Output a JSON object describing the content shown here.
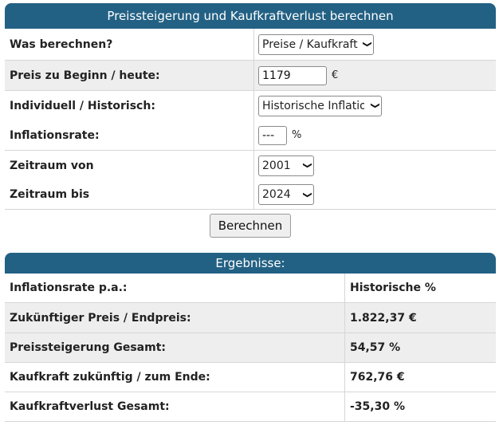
{
  "calc": {
    "title": "Preissteigerung und Kaufkraftverlust berechnen",
    "rows": {
      "what": {
        "label": "Was berechnen?",
        "select": "Preise / Kaufkraft"
      },
      "price": {
        "label": "Preis zu Beginn / heute:",
        "value": "1179",
        "unit": "€"
      },
      "mode": {
        "label": "Individuell / Historisch:",
        "select": "Historische Inflation"
      },
      "rate": {
        "label": "Inflationsrate:",
        "value": "---",
        "unit": "%"
      },
      "from": {
        "label": "Zeitraum von",
        "select": "2001"
      },
      "to": {
        "label": "Zeitraum bis",
        "select": "2024"
      }
    },
    "button": "Berechnen"
  },
  "results": {
    "title": "Ergebnisse:",
    "rows": [
      {
        "label": "Inflationsrate p.a.:",
        "value": "Historische %"
      },
      {
        "label": "Zukünftiger Preis / Endpreis:",
        "value": "1.822,37 €"
      },
      {
        "label": "Preissteigerung Gesamt:",
        "value": "54,57 %"
      },
      {
        "label": "Kaufkraft zukünftig / zum Ende:",
        "value": "762,76 €"
      },
      {
        "label": "Kaufkraftverlust Gesamt:",
        "value": "-35,30 %"
      }
    ]
  }
}
